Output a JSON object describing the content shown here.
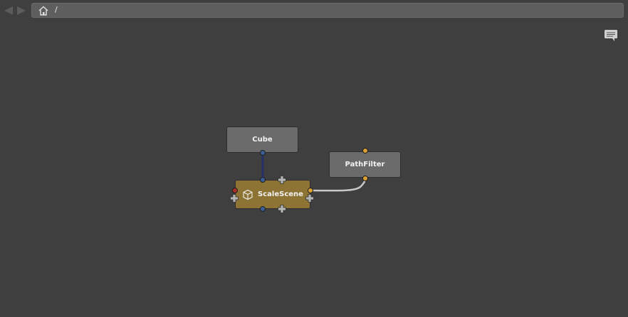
{
  "breadcrumb": {
    "path": "/"
  },
  "icons": {
    "back": "arrow-left-icon",
    "forward": "arrow-right-icon",
    "home": "home-icon",
    "notes": "speech-bubble-icon",
    "scene": "cube-outline-icon",
    "add_plug": "plus-icon"
  },
  "nodes": {
    "cube": {
      "label": "Cube"
    },
    "scale_scene": {
      "label": "ScaleScene"
    },
    "path_filter": {
      "label": "PathFilter"
    }
  },
  "colors": {
    "background": "#3f3f3f",
    "node_gray": "#6b6b6b",
    "node_highlight": "#8d7434",
    "plug_blue": "#3b5e95",
    "plug_gold": "#d9a132",
    "plug_red": "#a8302a",
    "wire_scene": "#27306b",
    "wire_filter": "#c8c8c8"
  }
}
